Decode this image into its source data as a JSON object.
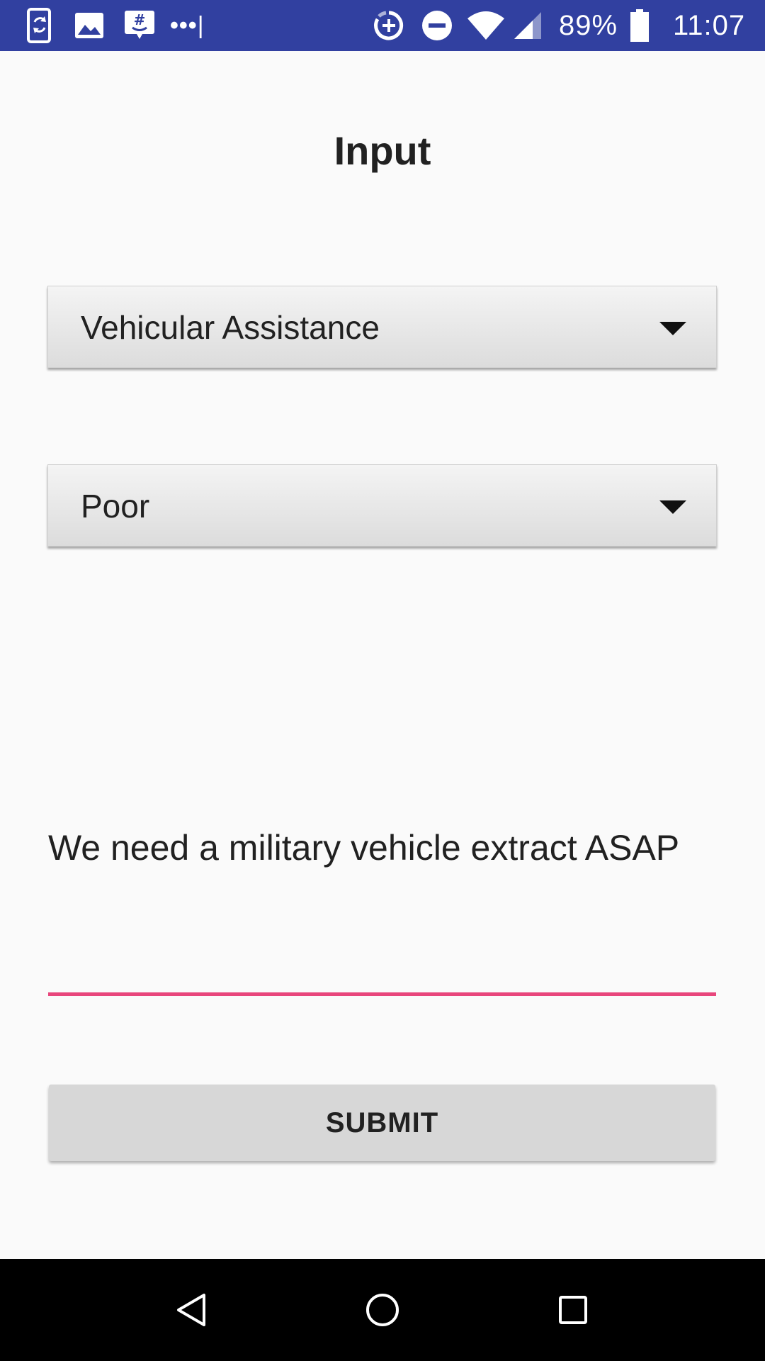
{
  "status_bar": {
    "battery_percent": "89%",
    "time": "11:07",
    "notification_more": "•••",
    "icons": [
      "phone-sync-icon",
      "image-icon",
      "chat-bubble-icon",
      "more-notifications-icon",
      "data-saver-icon",
      "do-not-disturb-icon",
      "wifi-icon",
      "cell-signal-icon",
      "battery-icon"
    ]
  },
  "screen": {
    "title": "Input"
  },
  "form": {
    "category_spinner": {
      "selected": "Vehicular Assistance"
    },
    "condition_spinner": {
      "selected": "Poor"
    },
    "message_field": {
      "value": "We need a military vehicle extract ASAP"
    },
    "submit_label": "SUBMIT"
  },
  "colors": {
    "status_bar": "#3140a0",
    "accent": "#e8467c",
    "background": "#fafafa"
  },
  "nav_bar": {
    "icons": [
      "back-icon",
      "home-icon",
      "recents-icon"
    ]
  }
}
